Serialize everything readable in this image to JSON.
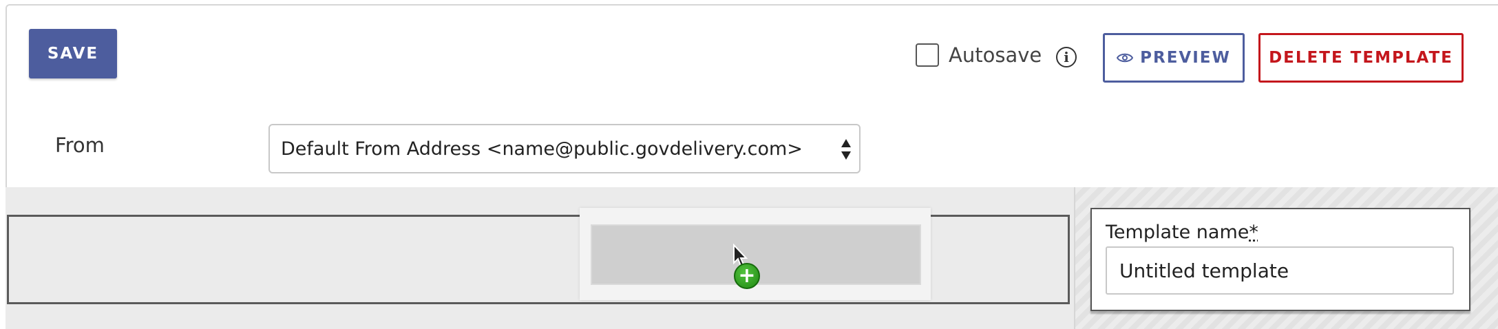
{
  "toolbar": {
    "save_label": "SAVE",
    "autosave_label": "Autosave",
    "autosave_checked": false,
    "preview_label": "PREVIEW",
    "delete_label": "DELETE TEMPLATE"
  },
  "from": {
    "label": "From",
    "selected": "Default From Address <name@public.govdelivery.com>"
  },
  "template": {
    "name_label": "Template name",
    "required_marker": "*",
    "name_value": "Untitled template"
  },
  "drag": {
    "badge": "+"
  },
  "colors": {
    "primary": "#4d5d9e",
    "danger": "#c4161c",
    "success": "#2aa31c"
  },
  "icons": {
    "info": "info-circle-icon",
    "preview": "eye-icon",
    "select": "select-arrows-icon",
    "cursor": "mouse-pointer-icon",
    "add": "plus-icon"
  }
}
